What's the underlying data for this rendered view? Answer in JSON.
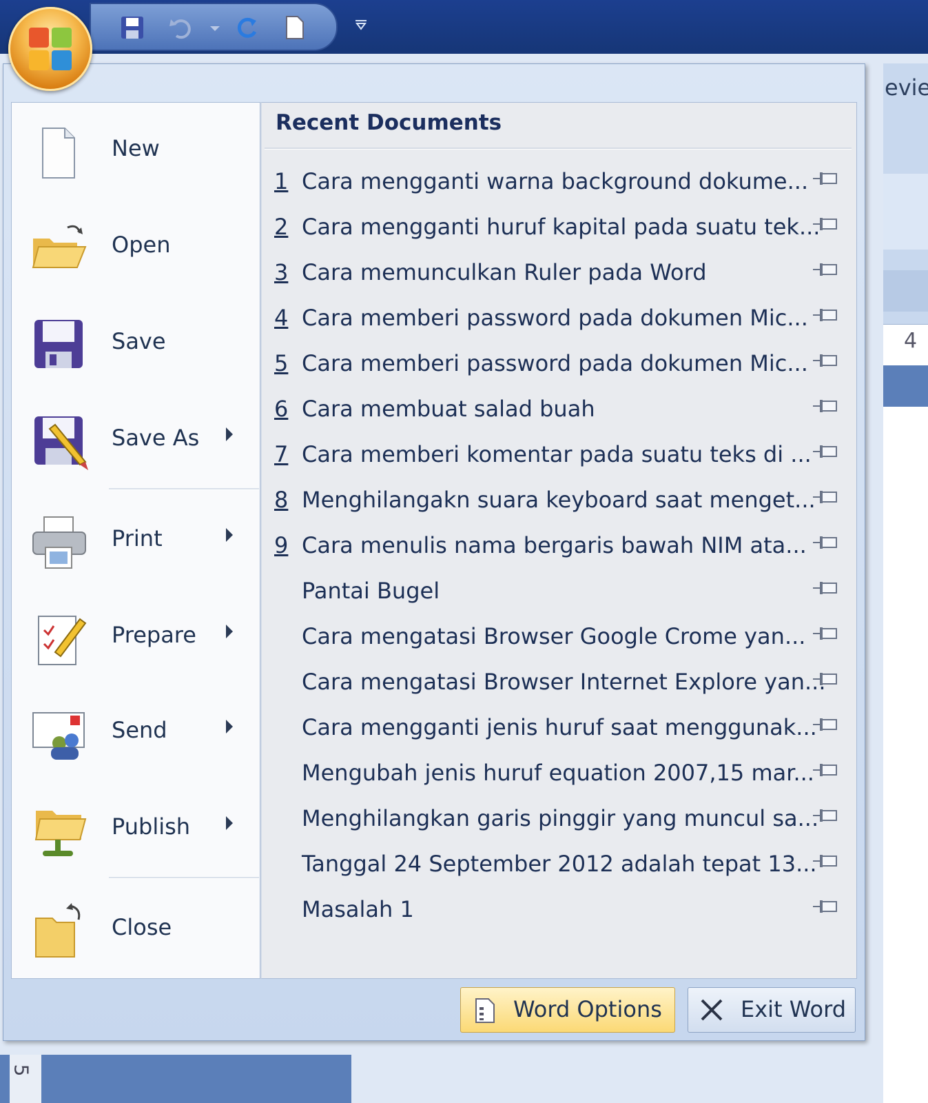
{
  "titlebar": {
    "quick_access_icons": [
      "save-icon",
      "undo-icon",
      "redo-icon",
      "new-document-icon",
      "customize-dropdown-icon"
    ]
  },
  "ribbon": {
    "tab_fragment": "eview",
    "ruler_mark": "4",
    "vertical_ruler_mark": "5"
  },
  "office_button": {
    "icon": "office-logo-icon"
  },
  "menu": {
    "items": [
      {
        "label": "New",
        "icon": "new-document-icon",
        "submenu": false
      },
      {
        "label": "Open",
        "icon": "open-folder-icon",
        "submenu": false
      },
      {
        "label": "Save",
        "icon": "save-icon",
        "submenu": false
      },
      {
        "label": "Save As",
        "icon": "save-as-icon",
        "submenu": true
      },
      {
        "label": "Print",
        "icon": "printer-icon",
        "submenu": true
      },
      {
        "label": "Prepare",
        "icon": "prepare-icon",
        "submenu": true
      },
      {
        "label": "Send",
        "icon": "send-icon",
        "submenu": true
      },
      {
        "label": "Publish",
        "icon": "publish-icon",
        "submenu": true
      },
      {
        "label": "Close",
        "icon": "close-folder-icon",
        "submenu": false
      }
    ]
  },
  "recent": {
    "title": "Recent Documents",
    "documents": [
      {
        "num": "1",
        "name": "Cara mengganti warna background dokume..."
      },
      {
        "num": "2",
        "name": "Cara mengganti huruf kapital pada suatu tek..."
      },
      {
        "num": "3",
        "name": "Cara memunculkan Ruler pada Word"
      },
      {
        "num": "4",
        "name": "Cara memberi password pada dokumen Mic..."
      },
      {
        "num": "5",
        "name": "Cara memberi password pada dokumen Mic..."
      },
      {
        "num": "6",
        "name": "Cara membuat salad buah"
      },
      {
        "num": "7",
        "name": "Cara memberi komentar pada suatu teks di ..."
      },
      {
        "num": "8",
        "name": "Menghilangakn suara keyboard saat menget..."
      },
      {
        "num": "9",
        "name": "Cara menulis nama bergaris bawah NIM ata..."
      },
      {
        "num": "",
        "name": "Pantai Bugel"
      },
      {
        "num": "",
        "name": "Cara mengatasi Browser Google Crome yan..."
      },
      {
        "num": "",
        "name": "Cara mengatasi Browser Internet Explore yan..."
      },
      {
        "num": "",
        "name": "Cara mengganti jenis huruf saat menggunak..."
      },
      {
        "num": "",
        "name": "Mengubah jenis huruf equation 2007,15 mar..."
      },
      {
        "num": "",
        "name": "Menghilangkan garis pinggir yang muncul sa..."
      },
      {
        "num": "",
        "name": "Tanggal 24 September 2012 adalah tepat 13..."
      },
      {
        "num": "",
        "name": "Masalah 1"
      }
    ]
  },
  "buttons": {
    "options_label": "Word Options",
    "exit_label": "Exit Word"
  },
  "colors": {
    "titlebar": "#1c3f8f",
    "menu_bg": "#dbe6f5",
    "text": "#1c2f55",
    "options_btn": "#fbd975"
  }
}
